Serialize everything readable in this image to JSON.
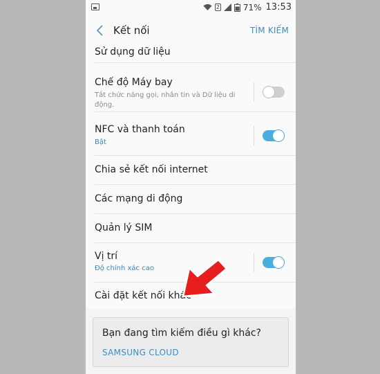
{
  "status_bar": {
    "battery": "71%",
    "time": "13:53"
  },
  "app_bar": {
    "title": "Kết nối",
    "search_label": "TÌM KIẾM"
  },
  "settings": [
    {
      "label": "Sử dụng dữ liệu"
    },
    {
      "label": "Chế độ Máy bay",
      "subtitle": "Tắt chức năng gọi, nhắn tin và Dữ liệu di động.",
      "toggle": "off"
    },
    {
      "label": "NFC và thanh toán",
      "subtitle": "Bật",
      "toggle": "on"
    },
    {
      "label": "Chia sẻ kết nối internet"
    },
    {
      "label": "Các mạng di động"
    },
    {
      "label": "Quản lý SIM"
    },
    {
      "label": "Vị trí",
      "subtitle": "Độ chính xác cao",
      "toggle": "on"
    },
    {
      "label": "Cài đặt kết nối khác"
    }
  ],
  "suggestion": {
    "question": "Bạn đang tìm kiếm điều gì khác?",
    "link": "SAMSUNG CLOUD"
  },
  "colors": {
    "accent": "#3b8dc4",
    "toggle_on": "#4aaede",
    "arrow": "#e61e1e"
  }
}
